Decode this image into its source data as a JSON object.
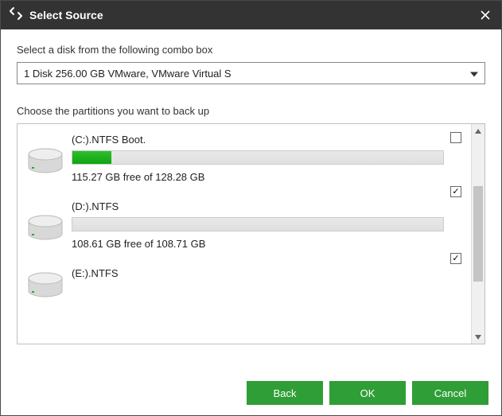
{
  "title": "Select Source",
  "labels": {
    "select_disk": "Select a disk from the following combo box",
    "choose_partitions": "Choose the partitions you want to back up"
  },
  "combo": {
    "selected": "1 Disk 256.00 GB VMware,  VMware Virtual S"
  },
  "partitions": [
    {
      "name": "(C:).NTFS Boot.",
      "free_text": "115.27 GB free of 128.28 GB",
      "used_pct": 10.5,
      "checked": false,
      "check_pos": "top"
    },
    {
      "name": "(D:).NTFS",
      "free_text": "108.61 GB free of 108.71 GB",
      "used_pct": 0.1,
      "checked": true,
      "check_pos": "bot"
    },
    {
      "name": "(E:).NTFS",
      "free_text": "",
      "used_pct": 0,
      "checked": true,
      "check_pos": "bot",
      "truncated": true
    }
  ],
  "buttons": {
    "back": "Back",
    "ok": "OK",
    "cancel": "Cancel"
  },
  "colors": {
    "accent": "#2f9e36",
    "titlebar": "#333333"
  }
}
